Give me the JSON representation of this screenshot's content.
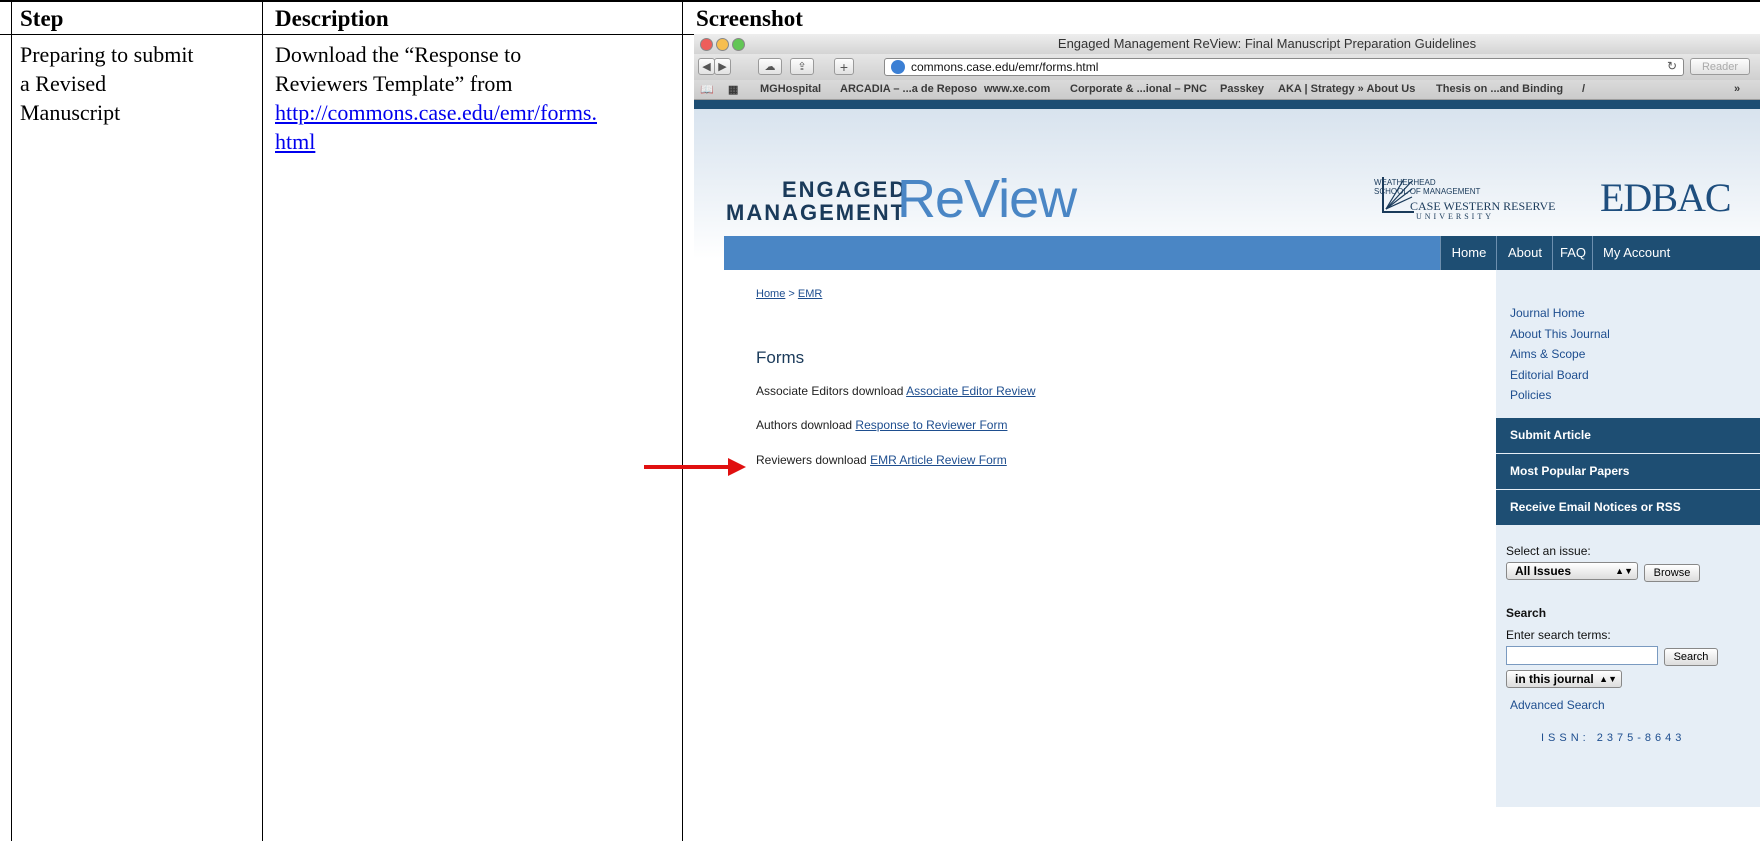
{
  "table": {
    "headers": {
      "step": "Step",
      "description": "Description",
      "screenshot": "Screenshot"
    },
    "row": {
      "step": [
        "Preparing to submit",
        "a Revised",
        "Manuscript"
      ],
      "description_lines": [
        "Download the “Response to",
        "Reviewers Template” from"
      ],
      "link_lines": [
        "http://commons.case.edu/emr/forms.",
        "html"
      ]
    }
  },
  "browser": {
    "window_title": "Engaged Management ReView: Final Manuscript Preparation Guidelines",
    "url": "commons.case.edu/emr/forms.html",
    "reader_label": "Reader",
    "bookmarks": [
      "MGHospital",
      "ARCADIA – ...a de Reposo",
      "www.xe.com",
      "Corporate & ...ional – PNC",
      "Passkey",
      "AKA | Strategy » About Us",
      "Thesis on ...and Binding",
      "/",
      "»"
    ]
  },
  "site": {
    "logo": {
      "line1": "ENGAGED",
      "line2": "MANAGEMENT",
      "review": "ReView"
    },
    "partner1": {
      "small": [
        "WEATHERHEAD",
        "SCHOOL OF MANAGEMENT"
      ],
      "main": "CASE WESTERN RESERVE",
      "sub": "UNIVERSITY"
    },
    "partner2": "EDBAC",
    "nav": [
      "Home",
      "About",
      "FAQ",
      "My Account"
    ],
    "breadcrumb": {
      "home": "Home",
      "sep": " > ",
      "current": "EMR"
    },
    "forms_title": "Forms",
    "forms": [
      {
        "prefix": "Associate Editors download ",
        "link": "Associate Editor Review"
      },
      {
        "prefix": "Authors download ",
        "link": "Response to Reviewer Form"
      },
      {
        "prefix": "Reviewers download ",
        "link": "EMR Article Review Form"
      }
    ],
    "sidebar": {
      "links": [
        "Journal Home",
        "About This Journal",
        "Aims & Scope",
        "Editorial Board",
        "Policies"
      ],
      "blocks": [
        "Submit Article",
        "Most Popular Papers",
        "Receive Email Notices or RSS"
      ],
      "select_issue_label": "Select an issue:",
      "issue_value": "All Issues",
      "browse_label": "Browse",
      "search_title": "Search",
      "search_terms_label": "Enter search terms:",
      "search_button": "Search",
      "scope_value": "in this journal",
      "advanced_search": "Advanced Search",
      "issn": "ISSN: 2375-8643"
    }
  }
}
